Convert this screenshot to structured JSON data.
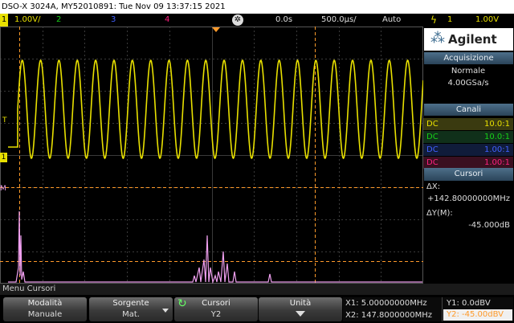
{
  "title_bar": "DSO-X 3024A, MY52010891: Tue Nov 09 13:37:15 2021",
  "status": {
    "ch1_num": "1",
    "ch1_scale": "1.00V/",
    "ch2_num": "2",
    "ch3_num": "3",
    "ch4_num": "4",
    "delay": "0.0s",
    "timebase": "500.0μs/",
    "trigger_mode": "Auto",
    "trigger_icon": "ϟ",
    "trigger_source": "1",
    "trigger_level": "1.00V"
  },
  "brand": {
    "logo": "⁂",
    "name": "Agilent"
  },
  "acquisition": {
    "header": "Acquisizione",
    "mode": "Normale",
    "rate": "4.00GSa/s"
  },
  "channels": {
    "header": "Canali",
    "rows": [
      {
        "coupling": "DC",
        "probe": "10.0:1",
        "color": "#e8e000"
      },
      {
        "coupling": "DC",
        "probe": "10.0:1",
        "color": "#18d018"
      },
      {
        "coupling": "DC",
        "probe": "1.00:1",
        "color": "#4060ff"
      },
      {
        "coupling": "DC",
        "probe": "1.00:1",
        "color": "#ff2080"
      }
    ]
  },
  "cursors": {
    "header": "Cursori",
    "dx_label": "ΔX:",
    "dx_value": "+142.80000000MHz",
    "dy_label": "ΔY(M):",
    "dy_value": "-45.000dB"
  },
  "markers": {
    "ch1": "1",
    "trig": "T",
    "math": "M"
  },
  "menu_title": "Menu Cursori",
  "softkeys": [
    {
      "label": "Modalità",
      "value": "Manuale"
    },
    {
      "label": "Sorgente",
      "value": "Mat."
    },
    {
      "label": "Cursori",
      "value": "Y2"
    },
    {
      "label": "Unità",
      "value": ""
    }
  ],
  "cursor_readout": {
    "x1": "X1: 5.00000000MHz",
    "x2": "X2: 147.8000000MHz",
    "y1": "Y1: 0.0dBV",
    "y2": "Y2: -45.00dBV"
  },
  "colors": {
    "ch1": "#e8e000",
    "ch2": "#18d018",
    "ch3": "#4060ff",
    "ch4": "#ff2080",
    "math": "#f0a0f0",
    "cursor": "#ff9a2a",
    "panel_header": "#3c5a74"
  }
}
